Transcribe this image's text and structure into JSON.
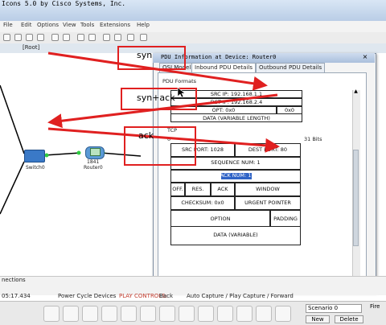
{
  "window": {
    "title": "Icons 5.0 by Cisco Systems, Inc.",
    "menu": [
      "File",
      "Edit",
      "Options",
      "View",
      "Tools",
      "Extensions",
      "Help"
    ],
    "breadcrumb": "[Root]"
  },
  "topology": {
    "devices": [
      {
        "name": "Switch0",
        "type": "switch"
      },
      {
        "name": "1841",
        "type": "router-model"
      },
      {
        "name": "Router0",
        "type": "router"
      }
    ]
  },
  "dialog": {
    "title": "PDU Information at Device: Router0",
    "tabs": [
      "OSI Model",
      "Inbound PDU Details",
      "Outbound PDU Details"
    ],
    "active_tab": "Inbound PDU Details",
    "section_label": "PDU Formats",
    "ip_fields": {
      "src_ip": "SRC IP: 192.168.1.1",
      "dst_ip": "DST IP: 192.168.2.4",
      "opt": "OPT: 0x0",
      "opt_val": "0x0",
      "data": "DATA (VARIABLE LENGTH)"
    },
    "tcp": {
      "label": "TCP",
      "bits_zero": "0",
      "bits_end": "31 Bits",
      "src_port": "SRC PORT: 1028",
      "dest_port": "DEST PORT: 80",
      "seq": "SEQUENCE NUM: 1",
      "ack": "ACK NUM: 1",
      "off": "OFF.",
      "res": "RES.",
      "ack_flag": "ACK",
      "window": "WINDOW",
      "checksum": "CHECKSUM: 0x0",
      "urgent": "URGENT POINTER",
      "option": "OPTION",
      "padding": "PADDING",
      "data": "DATA (VARIABLE)"
    }
  },
  "annotations": [
    "syn",
    "syn+ack",
    "ack"
  ],
  "status": {
    "time": "05:17.434",
    "power_cycle": "Power Cycle Devices",
    "play_controls": "PLAY CONTROLS:",
    "back": "Back",
    "auto_capture": "Auto Capture / Play",
    "capture_forward": "Capture / Forward",
    "left_panel": "nections",
    "scenario": "Scenario 0",
    "fire": "Fire",
    "new": "New",
    "delete": "Delete"
  },
  "colors": {
    "annotation": "#e02020",
    "highlight": "#2f63c6"
  }
}
